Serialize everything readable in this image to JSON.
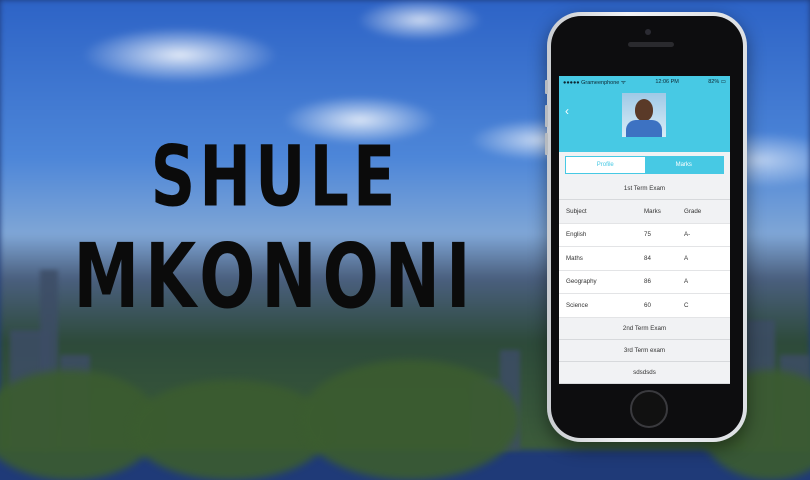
{
  "title": {
    "line1": "SHULE",
    "line2": "MKONONI"
  },
  "status_bar": {
    "carrier": "●●●●● Grameenphone ᯤ",
    "time": "12:06 PM",
    "battery": "82% ▭"
  },
  "profile": {
    "back_icon": "back-chevron-icon",
    "avatar": "student-photo"
  },
  "tabs": [
    {
      "label": "Profile",
      "active": false
    },
    {
      "label": "Marks",
      "active": true
    }
  ],
  "exam1": {
    "title": "1st Term Exam",
    "headers": {
      "subject": "Subject",
      "marks": "Marks",
      "grade": "Grade"
    },
    "rows": [
      {
        "subject": "English",
        "marks": "75",
        "grade": "A-"
      },
      {
        "subject": "Maths",
        "marks": "84",
        "grade": "A"
      },
      {
        "subject": "Geography",
        "marks": "86",
        "grade": "A"
      },
      {
        "subject": "Science",
        "marks": "60",
        "grade": "C"
      }
    ]
  },
  "exams_collapsed": [
    {
      "title": "2nd Term Exam"
    },
    {
      "title": "3rd Term exam"
    },
    {
      "title": "sdsdsds"
    }
  ],
  "colors": {
    "accent": "#47c9e4",
    "title_text": "#0b0b0b"
  }
}
